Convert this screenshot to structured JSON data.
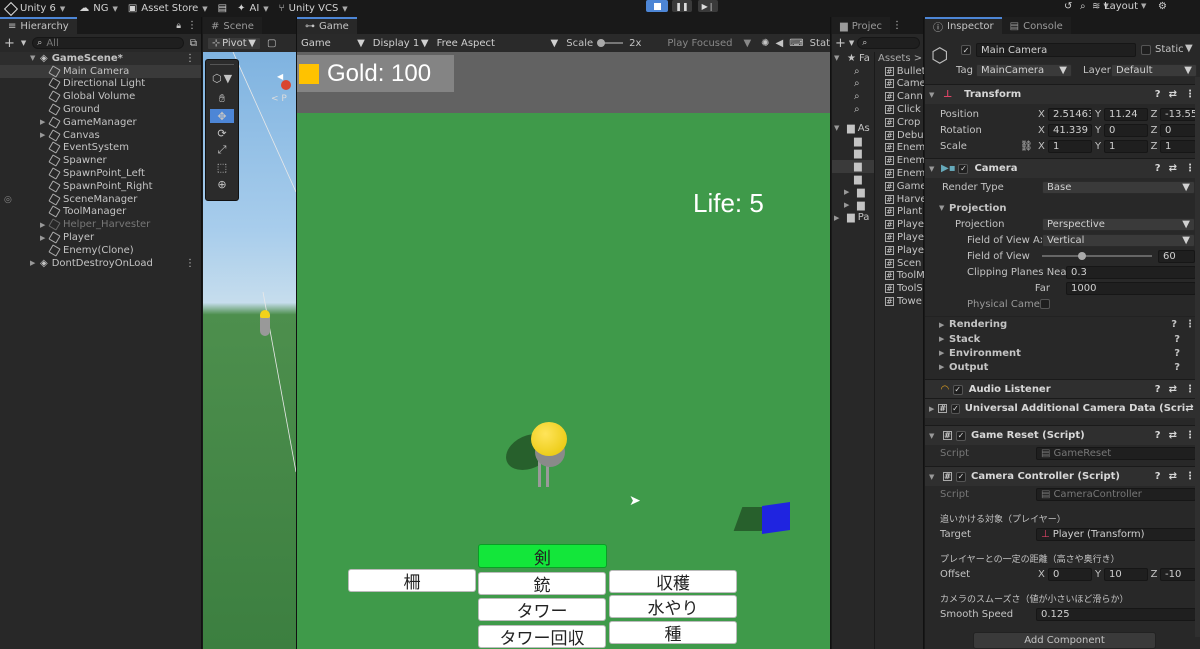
{
  "topbar": {
    "unity_label": "Unity 6",
    "account_label": "NG",
    "asset_store_label": "Asset Store",
    "ai_label": "AI",
    "vcs_label": "Unity VCS",
    "layout_label": "Layout"
  },
  "hierarchy": {
    "tab_label": "Hierarchy",
    "search_placeholder": "All",
    "scene_name": "GameScene*",
    "items": [
      {
        "label": "Main Camera"
      },
      {
        "label": "Directional Light"
      },
      {
        "label": "Global Volume"
      },
      {
        "label": "Ground"
      },
      {
        "label": "GameManager"
      },
      {
        "label": "Canvas"
      },
      {
        "label": "EventSystem"
      },
      {
        "label": "Spawner"
      },
      {
        "label": "SpawnPoint_Left"
      },
      {
        "label": "SpawnPoint_Right"
      },
      {
        "label": "SceneManager"
      },
      {
        "label": "ToolManager"
      },
      {
        "label": "Helper_Harvester"
      },
      {
        "label": "Player"
      },
      {
        "label": "Enemy(Clone)"
      }
    ],
    "dont_destroy": "DontDestroyOnLoad"
  },
  "scene": {
    "tab_label": "Scene",
    "pivot_label": "Pivot",
    "persp_label": "< P"
  },
  "game": {
    "tab_label": "Game",
    "mode_label": "Game",
    "display_label": "Display 1",
    "aspect_label": "Free Aspect",
    "scale_label": "Scale",
    "scale_value": "2x",
    "play_focused_label": "Play Focused",
    "stats_label": "Stat",
    "gold_text": "Gold: 100",
    "life_text": "Life: 5",
    "buttons": {
      "sword": "剣",
      "fence": "柵",
      "gun": "銃",
      "harvest": "収穫",
      "tower": "タワー",
      "water": "水やり",
      "tower_collect": "タワー回収",
      "seed": "種"
    }
  },
  "project": {
    "tab_label": "Projec",
    "favorites_label": "Fa",
    "assets_label": "As",
    "packages_label": "Pa",
    "breadcrumb": "Assets > S",
    "files": [
      "Bullet",
      "Came",
      "Cann",
      "Click",
      "Crop",
      "Debu",
      "Enem",
      "Enem",
      "Enem",
      "Game",
      "Harve",
      "Plant",
      "Playe",
      "Playe",
      "Playe",
      "Scen",
      "ToolM",
      "ToolS",
      "Towe"
    ]
  },
  "inspector": {
    "tab_label": "Inspector",
    "console_tab_label": "Console",
    "object_name": "Main Camera",
    "static_label": "Static",
    "tag_label": "Tag",
    "tag_value": "MainCamera",
    "layer_label": "Layer",
    "layer_value": "Default",
    "transform": {
      "title": "Transform",
      "position_label": "Position",
      "position": {
        "x": "2.51463",
        "y": "11.24",
        "z": "-13.550"
      },
      "rotation_label": "Rotation",
      "rotation": {
        "x": "41.339",
        "y": "0",
        "z": "0"
      },
      "scale_label": "Scale",
      "scale": {
        "x": "1",
        "y": "1",
        "z": "1"
      }
    },
    "camera": {
      "title": "Camera",
      "render_type_label": "Render Type",
      "render_type_value": "Base",
      "projection_section": "Projection",
      "projection_label": "Projection",
      "projection_value": "Perspective",
      "fov_axis_label": "Field of View Ax",
      "fov_axis_value": "Vertical",
      "fov_label": "Field of View",
      "fov_value": "60",
      "fov_fraction": 0.33,
      "clip_near_label": "Clipping Planes Near",
      "clip_near_value": "0.3",
      "clip_far_label": "Far",
      "clip_far_value": "1000",
      "physical_label": "Physical Camera",
      "rendering_label": "Rendering",
      "stack_label": "Stack",
      "environment_label": "Environment",
      "output_label": "Output"
    },
    "audio_listener_title": "Audio Listener",
    "urp_title": "Universal Additional Camera Data (Scri",
    "game_reset": {
      "title": "Game Reset (Script)",
      "script_label": "Script",
      "script_value": "GameReset"
    },
    "camera_controller": {
      "title": "Camera Controller (Script)",
      "script_label": "Script",
      "script_value": "CameraController",
      "target_header": "追いかける対象（プレイヤー）",
      "target_label": "Target",
      "target_value": "Player (Transform)",
      "offset_header": "プレイヤーとの一定の距離（高さや奥行き）",
      "offset_label": "Offset",
      "offset": {
        "x": "0",
        "y": "10",
        "z": "-10"
      },
      "smooth_header": "カメラのスムーズさ（値が小さいほど滑らか）",
      "smooth_label": "Smooth Speed",
      "smooth_value": "0.125"
    },
    "add_component_label": "Add Component"
  },
  "colors": {
    "accent": "#4d86d6",
    "ground": "#3f9a4a",
    "sky": "#626262",
    "player_yellow": "#f2d21c",
    "enemy_blue": "#1f24e0",
    "sword_green": "#13e63a",
    "gold_icon": "#ffc200"
  }
}
